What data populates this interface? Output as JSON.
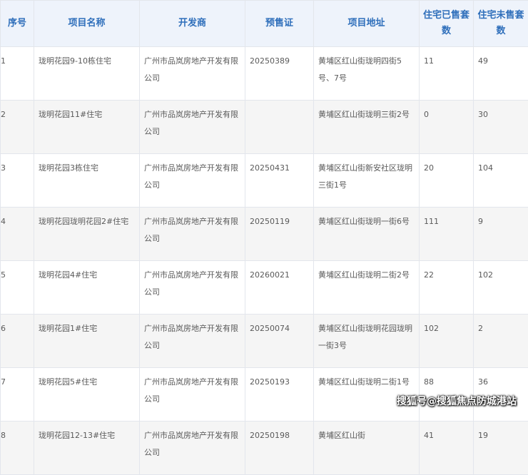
{
  "columns": [
    "序号",
    "项目名称",
    "开发商",
    "预售证",
    "项目地址",
    "住宅已售套数",
    "住宅未售套数"
  ],
  "rows": [
    [
      "1",
      "珑明花园9-10栋住宅",
      "广州市品岚房地产开发有限公司",
      "20250389",
      "黄埔区红山街珑明四街5号、7号",
      "11",
      "49"
    ],
    [
      "2",
      "珑明花园11#住宅",
      "广州市品岚房地产开发有限公司",
      "",
      "黄埔区红山街珑明三街2号",
      "0",
      "30"
    ],
    [
      "3",
      "珑明花园3栋住宅",
      "广州市品岚房地产开发有限公司",
      "20250431",
      "黄埔区红山街新安社区珑明三街1号",
      "20",
      "104"
    ],
    [
      "4",
      "珑明花园珑明花园2#住宅",
      "广州市品岚房地产开发有限公司",
      "20250119",
      "黄埔区红山街珑明一街6号",
      "111",
      "9"
    ],
    [
      "5",
      "珑明花园4#住宅",
      "广州市品岚房地产开发有限公司",
      "20260021",
      "黄埔区红山街珑明二街2号",
      "22",
      "102"
    ],
    [
      "6",
      "珑明花园1#住宅",
      "广州市品岚房地产开发有限公司",
      "20250074",
      "黄埔区红山街珑明花园珑明一街3号",
      "102",
      "2"
    ],
    [
      "7",
      "珑明花园5#住宅",
      "广州市品岚房地产开发有限公司",
      "20250193",
      "黄埔区红山街珑明二街1号",
      "88",
      "36"
    ],
    [
      "8",
      "珑明花园12-13#住宅",
      "广州市品岚房地产开发有限公司",
      "20250198",
      "黄埔区红山街",
      "41",
      "19"
    ]
  ],
  "watermark": "搜狐号@搜狐焦点防城港站"
}
